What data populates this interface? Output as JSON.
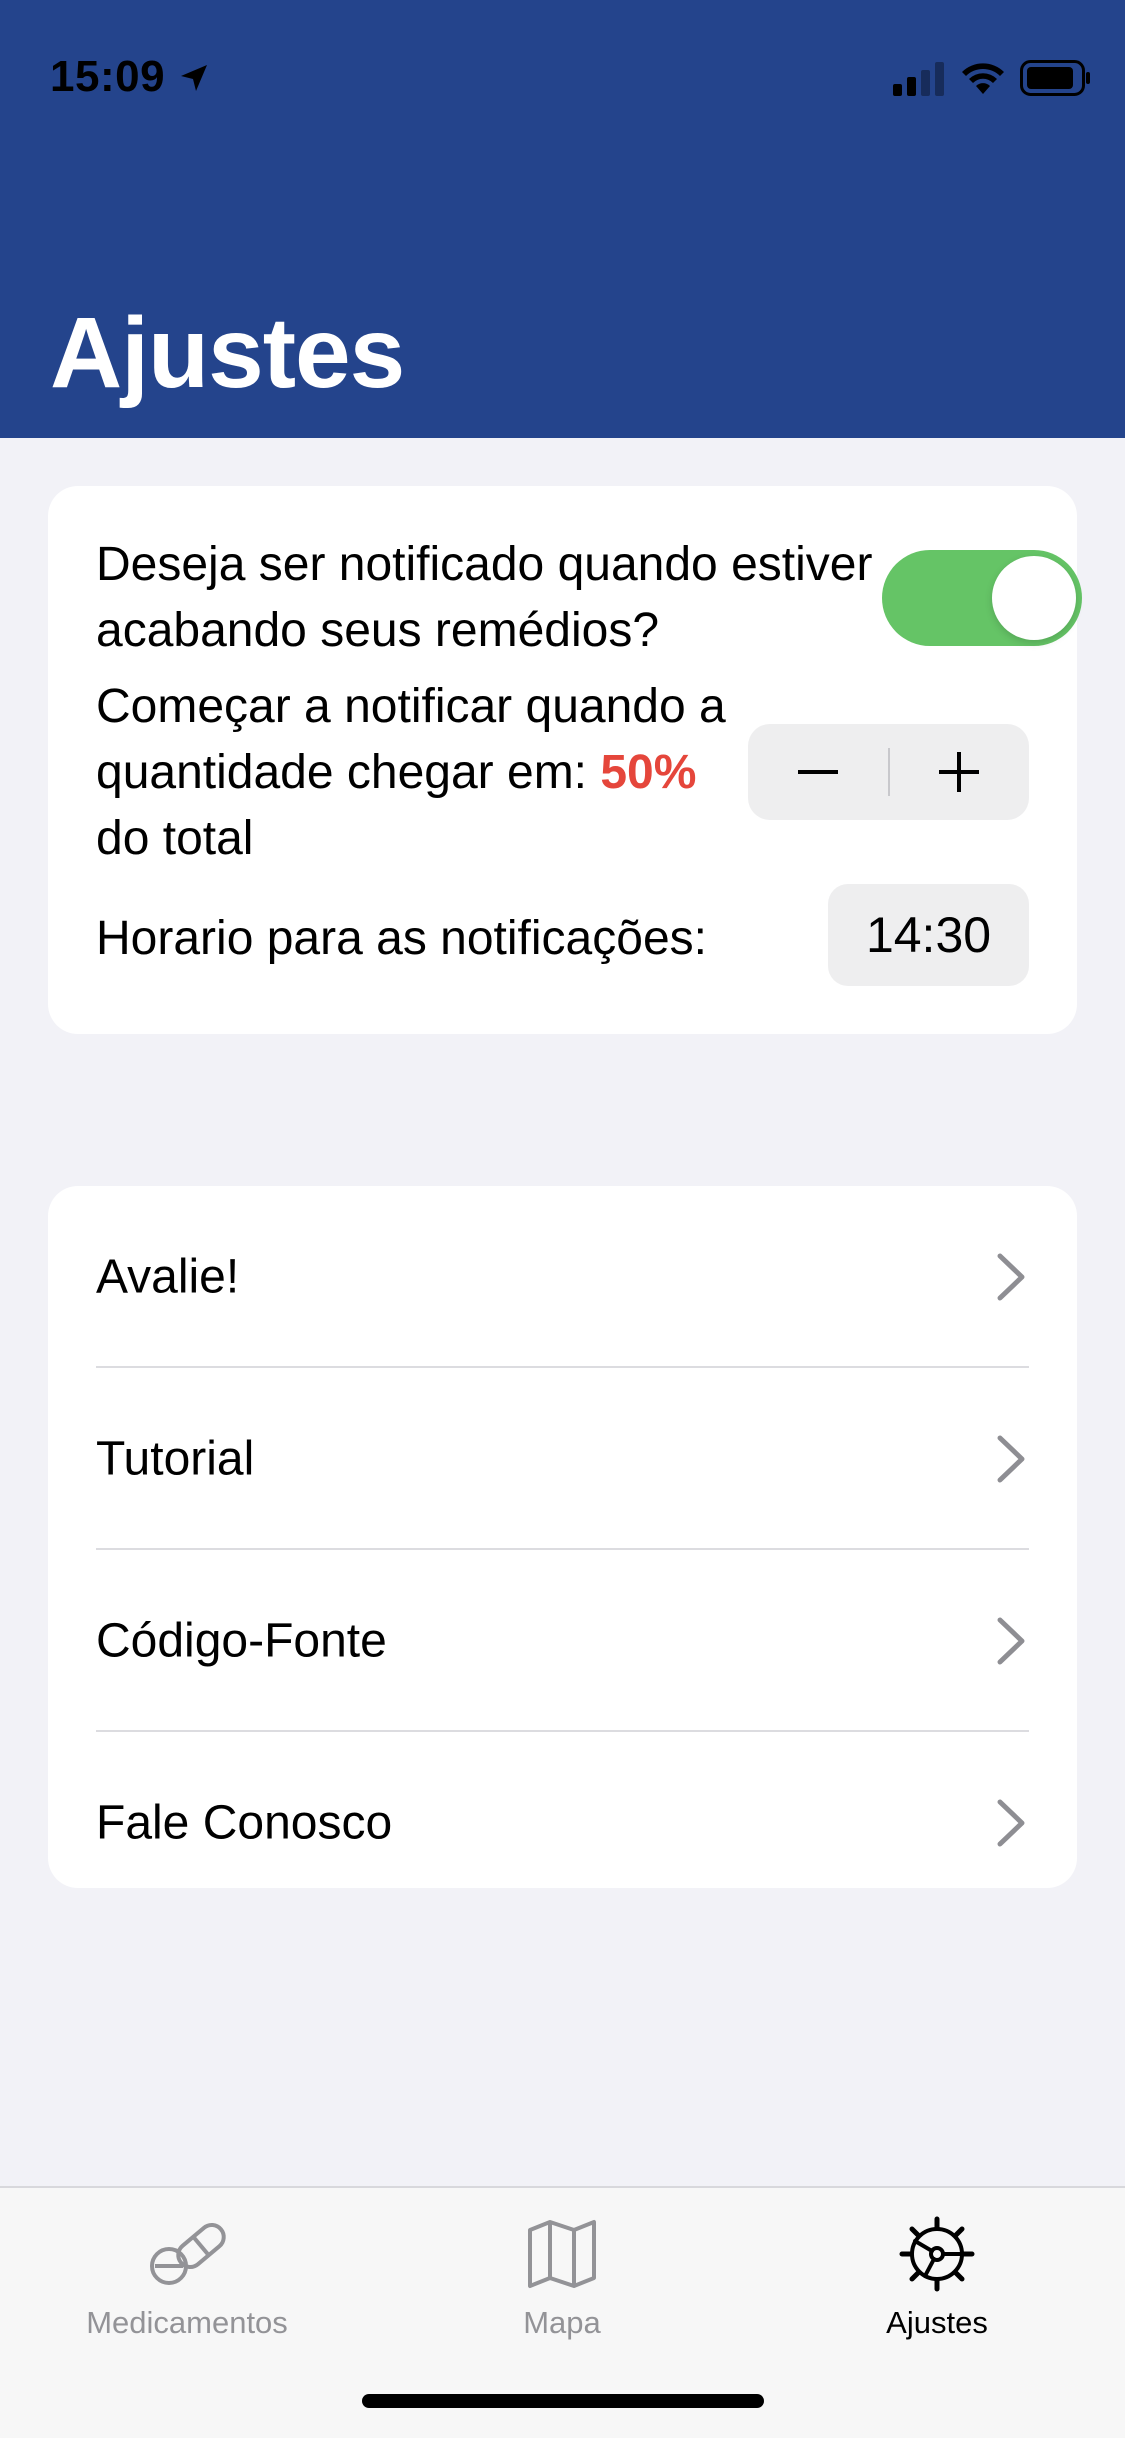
{
  "status_bar": {
    "time": "15:09",
    "icons": [
      "location-arrow-icon",
      "cellular-signal-icon",
      "wifi-icon",
      "battery-icon"
    ]
  },
  "header": {
    "title": "Ajustes",
    "background_color": "#24448c"
  },
  "notifications_card": {
    "question": "Deseja ser notificado quando estiver acabando seus remédios?",
    "toggle_on": true,
    "toggle_color": "#65c466",
    "threshold_prefix": "Começar a notificar quando a quantidade chegar em: ",
    "threshold_value": "50%",
    "threshold_suffix": " do total",
    "threshold_color": "#e5463b",
    "stepper_minus": "minus-icon",
    "stepper_plus": "plus-icon",
    "time_label": "Horario para as notificações:",
    "time_value": "14:30"
  },
  "links": [
    {
      "label": "Avalie!"
    },
    {
      "label": "Tutorial"
    },
    {
      "label": "Código-Fonte"
    },
    {
      "label": "Fale Conosco"
    }
  ],
  "tab_bar": {
    "tabs": [
      {
        "label": "Medicamentos",
        "icon": "pill-icon",
        "active": false
      },
      {
        "label": "Mapa",
        "icon": "map-icon",
        "active": false
      },
      {
        "label": "Ajustes",
        "icon": "gear-icon",
        "active": true
      }
    ]
  }
}
